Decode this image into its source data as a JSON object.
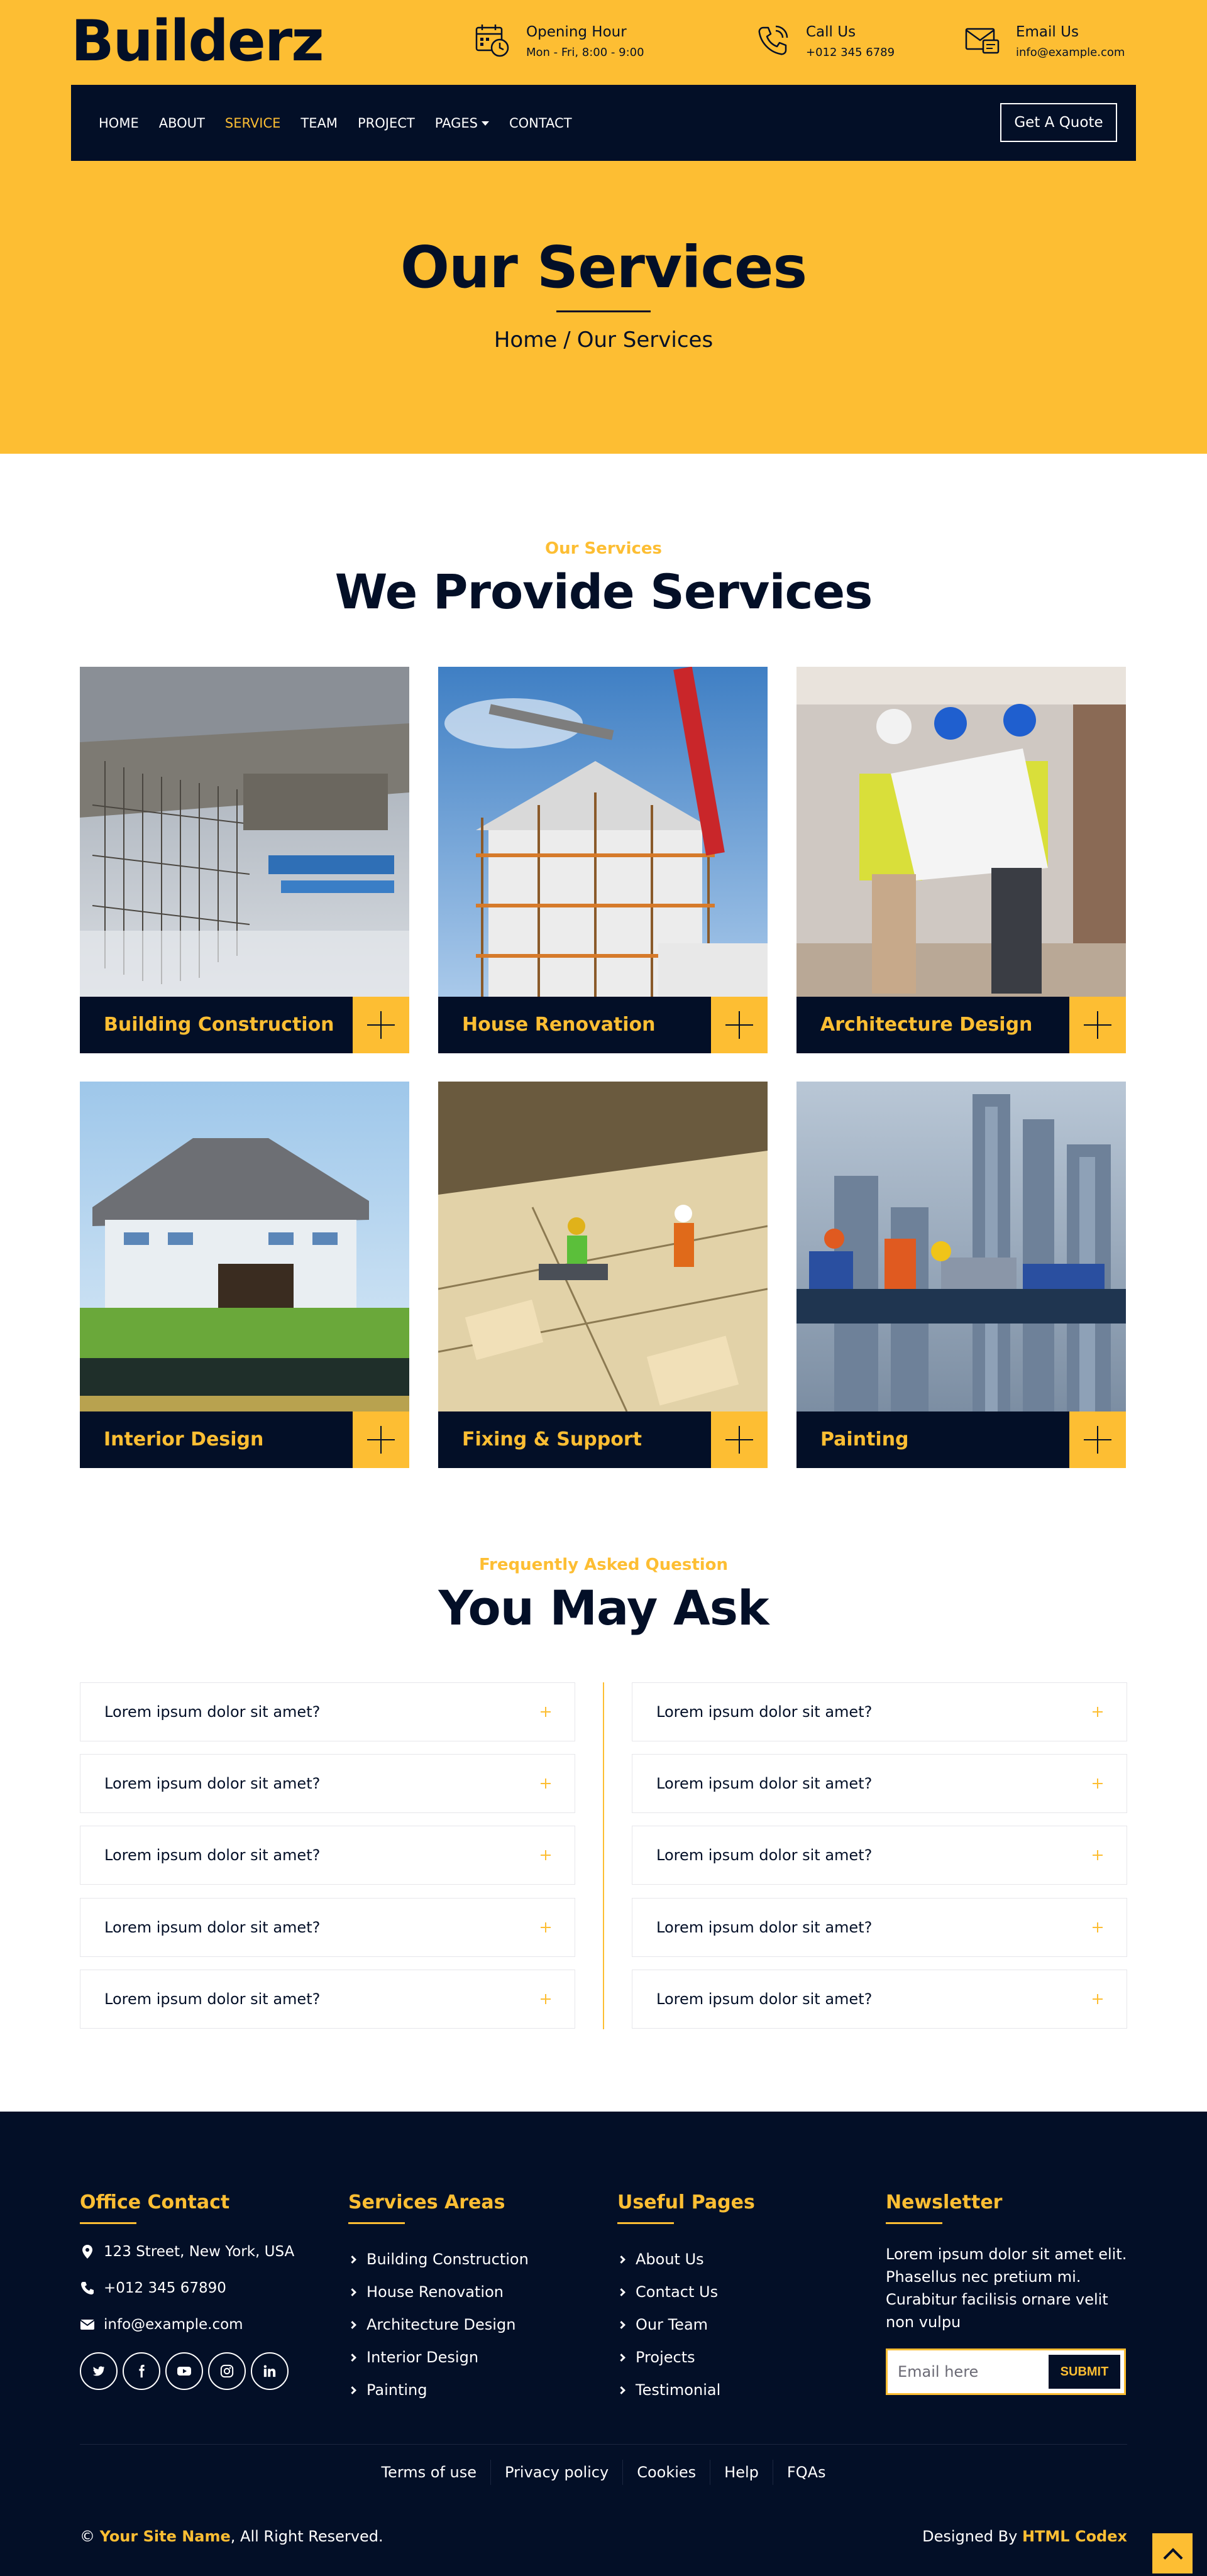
{
  "brand": {
    "logo": "Builderz",
    "primary": "#fdbe33",
    "dark": "#030f27"
  },
  "header": {
    "info": [
      {
        "icon": "calendar-clock-icon",
        "title": "Opening Hour",
        "sub": "Mon - Fri, 8:00 - 9:00"
      },
      {
        "icon": "phone-call-icon",
        "title": "Call Us",
        "sub": "+012 345 6789"
      },
      {
        "icon": "email-icon",
        "title": "Email Us",
        "sub": "info@example.com"
      }
    ],
    "nav": [
      {
        "label": "HOME",
        "active": false
      },
      {
        "label": "ABOUT",
        "active": false
      },
      {
        "label": "SERVICE",
        "active": true
      },
      {
        "label": "TEAM",
        "active": false
      },
      {
        "label": "PROJECT",
        "active": false
      },
      {
        "label": "PAGES",
        "active": false,
        "dropdown": true
      },
      {
        "label": "CONTACT",
        "active": false
      }
    ],
    "quote_button": "Get A Quote"
  },
  "hero": {
    "title": "Our Services",
    "breadcrumb": [
      "Home",
      "Our Services"
    ]
  },
  "services": {
    "subtitle": "Our Services",
    "title": "We Provide Services",
    "items": [
      {
        "name": "Building Construction",
        "image": "construction-site-rebar"
      },
      {
        "name": "House Renovation",
        "image": "house-scaffolding-crane"
      },
      {
        "name": "Architecture Design",
        "image": "engineers-with-blueprint"
      },
      {
        "name": "Interior Design",
        "image": "house-under-construction"
      },
      {
        "name": "Fixing & Support",
        "image": "workers-on-site-aerial"
      },
      {
        "name": "Painting",
        "image": "workers-on-steel-beam"
      }
    ]
  },
  "faq": {
    "subtitle": "Frequently Asked Question",
    "title": "You May Ask",
    "left": [
      "Lorem ipsum dolor sit amet?",
      "Lorem ipsum dolor sit amet?",
      "Lorem ipsum dolor sit amet?",
      "Lorem ipsum dolor sit amet?",
      "Lorem ipsum dolor sit amet?"
    ],
    "right": [
      "Lorem ipsum dolor sit amet?",
      "Lorem ipsum dolor sit amet?",
      "Lorem ipsum dolor sit amet?",
      "Lorem ipsum dolor sit amet?",
      "Lorem ipsum dolor sit amet?"
    ]
  },
  "footer": {
    "office": {
      "title": "Office Contact",
      "address": "123 Street, New York, USA",
      "phone": "+012 345 67890",
      "email": "info@example.com",
      "social": [
        "twitter-icon",
        "facebook-icon",
        "youtube-icon",
        "instagram-icon",
        "linkedin-icon"
      ]
    },
    "services": {
      "title": "Services Areas",
      "links": [
        "Building Construction",
        "House Renovation",
        "Architecture Design",
        "Interior Design",
        "Painting"
      ]
    },
    "pages": {
      "title": "Useful Pages",
      "links": [
        "About Us",
        "Contact Us",
        "Our Team",
        "Projects",
        "Testimonial"
      ]
    },
    "newsletter": {
      "title": "Newsletter",
      "text": "Lorem ipsum dolor sit amet elit. Phasellus nec pretium mi. Curabitur facilisis ornare velit non vulpu",
      "placeholder": "Email here",
      "button": "SUBMIT"
    },
    "menu": [
      "Terms of use",
      "Privacy policy",
      "Cookies",
      "Help",
      "FQAs"
    ],
    "copyright": {
      "prefix": "©",
      "site": "Your Site Name",
      "suffix": ", All Right Reserved."
    },
    "designed": {
      "prefix": "Designed By",
      "name": "HTML Codex"
    }
  }
}
